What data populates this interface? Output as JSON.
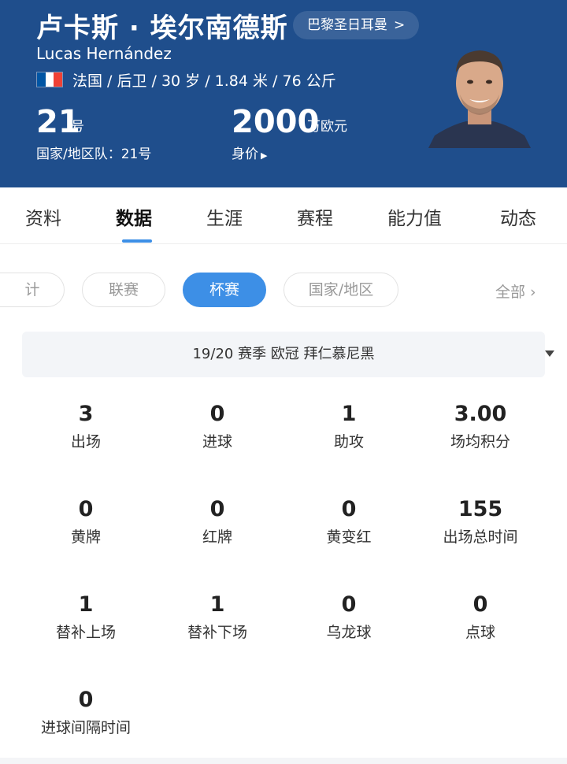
{
  "header": {
    "name_cn": "卢卡斯 · 埃尔南德斯",
    "club": "巴黎圣日耳曼",
    "club_arrow": ">",
    "name_en": "Lucas Hernández",
    "details": "法国 / 后卫 / 30 岁 / 1.84 米 / 76 公斤",
    "number": "21",
    "number_unit": "号",
    "national_team": "国家/地区队：21号",
    "market_value": "2000",
    "market_value_unit": "万欧元",
    "market_value_label": "身价",
    "flag_colors": [
      "#0055a4",
      "#ffffff",
      "#ef4135"
    ]
  },
  "tabs": [
    "资料",
    "数据",
    "生涯",
    "赛程",
    "能力值",
    "动态"
  ],
  "filters": {
    "cut_label": "计",
    "items": [
      "联赛",
      "杯赛",
      "国家/地区"
    ],
    "all": "全部",
    "all_icon": "chevron-right-icon"
  },
  "season": "19/20 赛季  欧冠  拜仁慕尼黑",
  "stats": [
    {
      "value": "3",
      "label": "出场"
    },
    {
      "value": "0",
      "label": "进球"
    },
    {
      "value": "1",
      "label": "助攻"
    },
    {
      "value": "3.00",
      "label": "场均积分"
    },
    {
      "value": "0",
      "label": "黄牌"
    },
    {
      "value": "0",
      "label": "红牌"
    },
    {
      "value": "0",
      "label": "黄变红"
    },
    {
      "value": "155",
      "label": "出场总时间"
    },
    {
      "value": "1",
      "label": "替补上场"
    },
    {
      "value": "1",
      "label": "替补下场"
    },
    {
      "value": "0",
      "label": "乌龙球"
    },
    {
      "value": "0",
      "label": "点球"
    },
    {
      "value": "0",
      "label": "进球间隔时间"
    }
  ],
  "colors": {
    "header_bg": "#1f4e8c",
    "accent": "#3d8fe6"
  }
}
